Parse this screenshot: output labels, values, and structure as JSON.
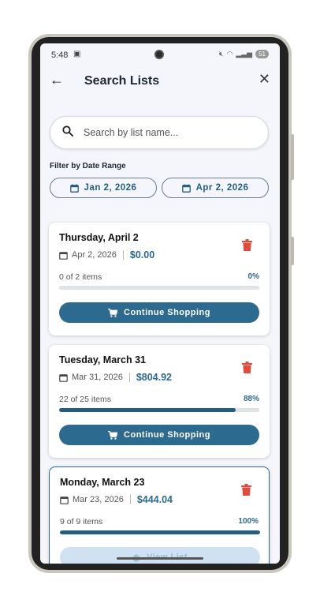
{
  "status": {
    "time": "5:48",
    "battery": "51"
  },
  "header": {
    "title": "Search Lists"
  },
  "search": {
    "placeholder": "Search by list name..."
  },
  "filter": {
    "label": "Filter by Date Range",
    "start_date": "Jan 2, 2026",
    "end_date": "Apr 2, 2026"
  },
  "lists": [
    {
      "title": "Thursday, April 2",
      "date": "Apr 2, 2026",
      "amount": "$0.00",
      "items": "0 of 2 items",
      "percent": "0%",
      "progress": 0,
      "action": "Continue Shopping"
    },
    {
      "title": "Tuesday, March 31",
      "date": "Mar 31, 2026",
      "amount": "$804.92",
      "items": "22 of 25 items",
      "percent": "88%",
      "progress": 0.88,
      "action": "Continue Shopping"
    },
    {
      "title": "Monday, March 23",
      "date": "Mar 23, 2026",
      "amount": "$444.04",
      "items": "9 of 9 items",
      "percent": "100%",
      "progress": 1.0,
      "action": "View List"
    }
  ],
  "colors": {
    "accent": "#2d6a8f",
    "danger": "#e04b3c",
    "background": "#f4f6fb"
  }
}
